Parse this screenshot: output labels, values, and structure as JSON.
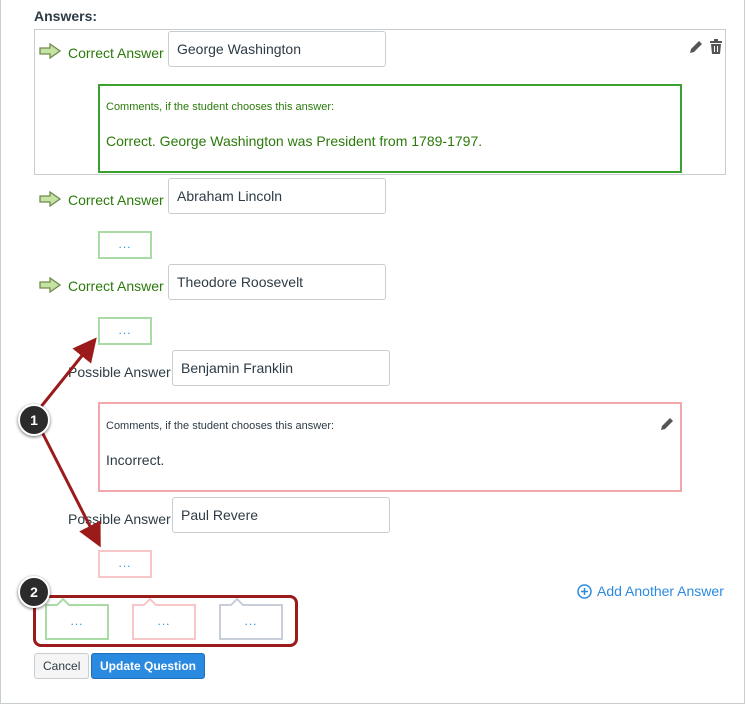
{
  "heading": "Answers:",
  "answers": [
    {
      "label": "Correct Answer",
      "value": "George Washington"
    },
    {
      "label": "Correct Answer",
      "value": "Abraham Lincoln"
    },
    {
      "label": "Correct Answer",
      "value": "Theodore Roosevelt"
    },
    {
      "label": "Possible Answer",
      "value": "Benjamin Franklin"
    },
    {
      "label": "Possible Answer",
      "value": "Paul Revere"
    }
  ],
  "comments": {
    "label": "Comments, if the student chooses this answer:",
    "correct_text": "Correct. George Washington was President from 1789-1797.",
    "incorrect_text": "Incorrect."
  },
  "dots": "...",
  "add_another": "Add Another Answer",
  "buttons": {
    "cancel": "Cancel",
    "update": "Update Question"
  },
  "callouts": [
    "1",
    "2"
  ],
  "colors": {
    "correct": "#2b7a0b",
    "correct_border": "#3aa02f",
    "incorrect_border": "#f3a6ab",
    "link": "#2a8ae0",
    "callout_arrow": "#9b1a1a"
  }
}
